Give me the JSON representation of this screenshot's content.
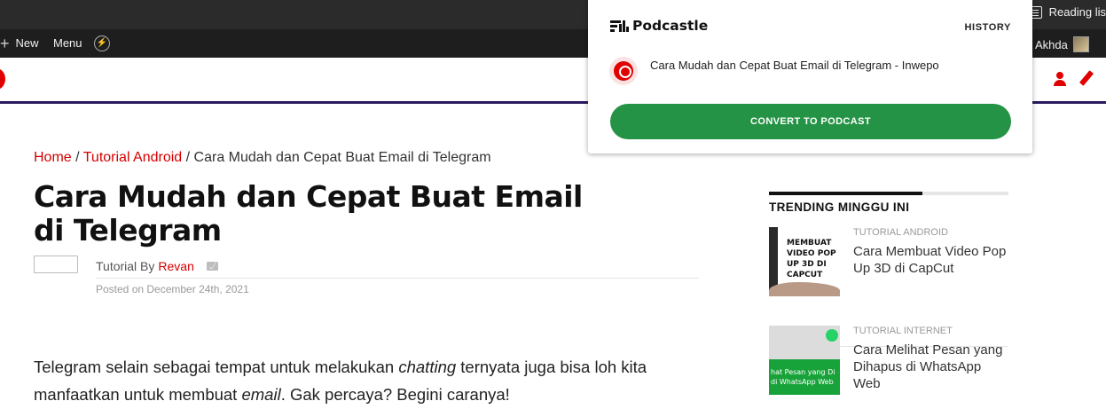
{
  "browser": {
    "reading_list_label": "Reading lis"
  },
  "admin_bar": {
    "new_label": "New",
    "menu_label": "Menu",
    "user_name": "rza Akhda"
  },
  "breadcrumb": {
    "home": "Home",
    "sep1": " / ",
    "category": "Tutorial Android",
    "sep2": " / ",
    "current": "Cara Mudah dan Cepat Buat Email di Telegram"
  },
  "post": {
    "title": "Cara Mudah dan Cepat Buat Email di Telegram",
    "byline_prefix": "Tutorial By",
    "author": "Revan",
    "posted_on": "Posted on December 24th, 2021",
    "body": {
      "p1_a": "Telegram selain sebagai tempat untuk melakukan ",
      "p1_em1": "chatting",
      "p1_b": " ternyata juga bisa loh kita manfaatkan untuk membuat ",
      "p1_em2": "email",
      "p1_c": ". Gak percaya? Begini caranya!"
    }
  },
  "sidebar": {
    "section_title": "TRENDING MINGGU INI",
    "items": [
      {
        "category": "TUTORIAL ANDROID",
        "headline": "Cara Membuat Video Pop Up 3D di CapCut",
        "thumb_text": "MEMBUAT VIDEO POP UP 3D DI CAPCUT"
      },
      {
        "category": "TUTORIAL INTERNET",
        "headline": "Cara Melihat Pesan yang Dihapus di WhatsApp Web",
        "thumb_text": "hat Pesan yang Di di WhatsApp Web"
      }
    ]
  },
  "podcastle": {
    "brand": "Podcastle",
    "history_label": "HISTORY",
    "page_title": "Cara Mudah dan Cepat Buat Email di Telegram - Inwepo",
    "convert_label": "CONVERT TO PODCAST",
    "accent_color": "#259345"
  },
  "colors": {
    "link_red": "#d40000",
    "header_border": "#2a1a5e"
  }
}
